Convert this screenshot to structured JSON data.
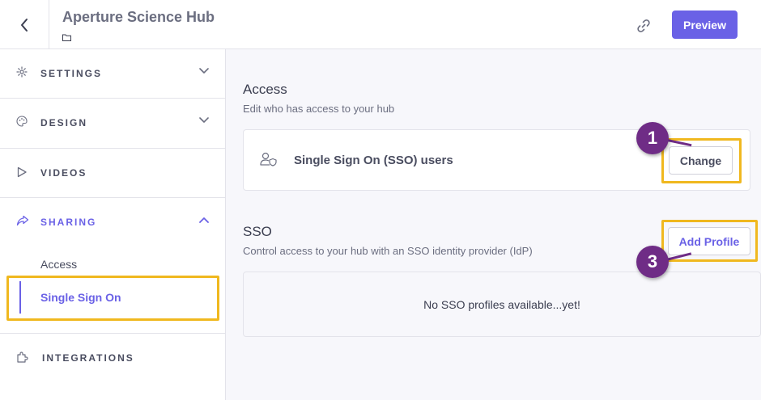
{
  "header": {
    "title": "Aperture Science Hub",
    "preview_label": "Preview"
  },
  "sidebar": {
    "sections": [
      {
        "label": "SETTINGS",
        "icon": "gear-icon"
      },
      {
        "label": "DESIGN",
        "icon": "palette-icon"
      },
      {
        "label": "VIDEOS",
        "icon": "play-icon"
      },
      {
        "label": "SHARING",
        "icon": "share-icon",
        "expanded": true
      },
      {
        "label": "INTEGRATIONS",
        "icon": "puzzle-icon"
      }
    ],
    "sharing_items": [
      "Access",
      "Single Sign On"
    ],
    "active_item": "Single Sign On"
  },
  "access": {
    "title": "Access",
    "subtitle": "Edit who has access to your hub",
    "option_label": "Single Sign On (SSO) users",
    "change_label": "Change"
  },
  "sso": {
    "title": "SSO",
    "subtitle": "Control access to your hub with an SSO identity provider (IdP)",
    "add_profile_label": "Add Profile",
    "empty_message": "No SSO profiles available...yet!"
  },
  "annotations": {
    "step_change": "1",
    "step_add_profile": "3",
    "highlight_color": "#f0b81f",
    "badge_color": "#6f2c86"
  },
  "colors": {
    "accent": "#6a61e6"
  }
}
